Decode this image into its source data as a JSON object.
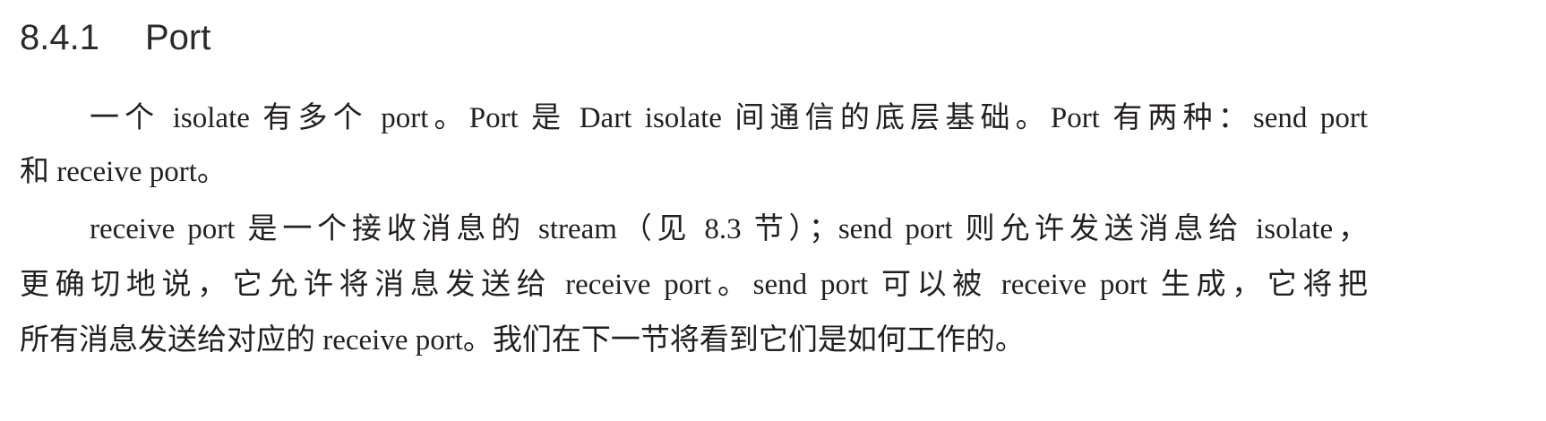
{
  "section": {
    "number": "8.4.1",
    "title": "Port"
  },
  "paragraphs": [
    {
      "lines": [
        "一个 isolate 有多个 port。Port 是 Dart isolate 间通信的底层基础。Port 有两种：send port",
        "和 receive port。"
      ]
    },
    {
      "lines": [
        "receive port 是一个接收消息的 stream（见 8.3 节）；send port 则允许发送消息给 isolate，",
        "更确切地说，它允许将消息发送给 receive port。send port 可以被 receive port 生成，它将把",
        "所有消息发送给对应的 receive port。我们在下一节将看到它们是如何工作的。"
      ]
    }
  ]
}
